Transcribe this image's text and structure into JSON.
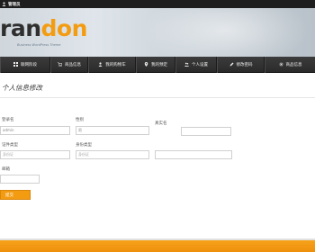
{
  "topbar": {
    "admin_label": "管理员"
  },
  "banner": {
    "logo_part1": "ran",
    "logo_part2": "don",
    "tagline": "Business WordPress Theme"
  },
  "nav": {
    "items": [
      {
        "label": "联网阶段",
        "icon": "grid-icon"
      },
      {
        "label": "商品信息",
        "icon": "cart-icon"
      },
      {
        "label": "我的购物车",
        "icon": "user-icon"
      },
      {
        "label": "我的预定",
        "icon": "pin-icon"
      },
      {
        "label": "个人设置",
        "icon": "people-icon"
      },
      {
        "label": "修改密码",
        "icon": "pencil-icon"
      },
      {
        "label": "商品信息",
        "icon": "gear-icon"
      }
    ]
  },
  "page": {
    "title": "个人信息修改"
  },
  "form": {
    "field1": {
      "label": "登录名",
      "value": "admin"
    },
    "field2": {
      "label": "性别",
      "value": "男"
    },
    "field3": {
      "label": "真实名",
      "value": ""
    },
    "field4": {
      "label": "证件类型",
      "placeholder": "身份证"
    },
    "field5": {
      "label": "身份类型",
      "placeholder": "身份证"
    },
    "field6": {
      "value": ""
    },
    "field7": {
      "label": "邮箱",
      "value": ""
    },
    "submit_label": "提交"
  },
  "colors": {
    "accent": "#f39c12",
    "nav_bg": "#333333",
    "topbar_bg": "#1e1e1e"
  }
}
